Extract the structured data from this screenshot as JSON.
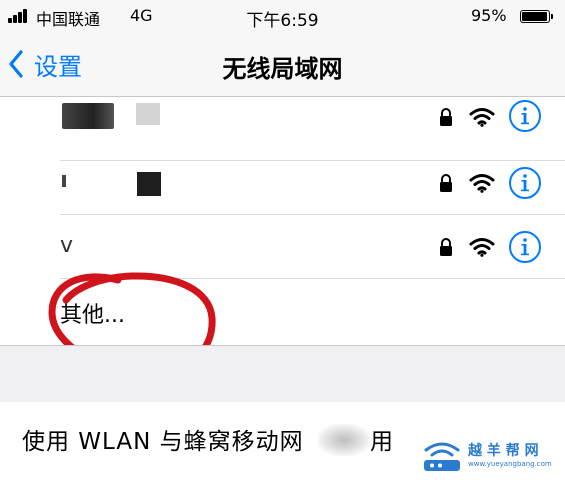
{
  "status_bar": {
    "carrier": "中国联通",
    "network": "4G",
    "time": "下午6:59",
    "battery_percent": "95%",
    "battery_level": 0.95
  },
  "nav": {
    "back_label": "设置",
    "title": "无线局域网"
  },
  "networks": [
    {
      "name": "",
      "secured": true,
      "icon": "wifi-icon"
    },
    {
      "name": "",
      "secured": true,
      "icon": "wifi-icon"
    },
    {
      "name": "v",
      "secured": true,
      "icon": "wifi-icon"
    }
  ],
  "other_label": "其他...",
  "wlan_cellular_label": "使用 WLAN 与蜂窝移动网",
  "wlan_cellular_tail": "用",
  "watermark": {
    "text": "越 羊 帮 网",
    "url": "www.yueyangbang.com"
  },
  "colors": {
    "accent": "#007aff",
    "annotation": "#d0141c"
  }
}
